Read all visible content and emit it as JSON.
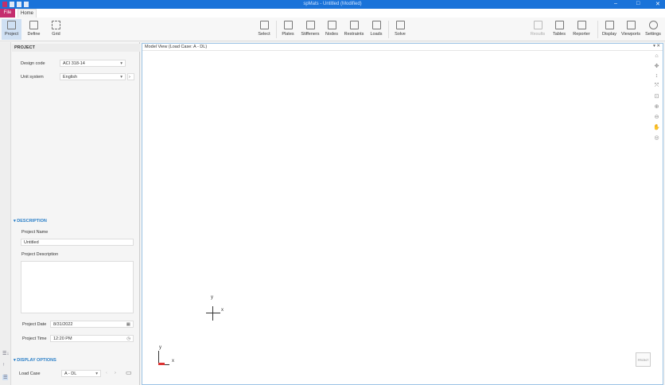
{
  "window": {
    "title": "spMats - Untitled (Modified)",
    "minimize": "–",
    "maximize": "□",
    "close": "✕"
  },
  "tabs": {
    "file": "File",
    "home": "Home"
  },
  "ribbon": {
    "left": [
      {
        "label": "Project",
        "icon": "project-icon"
      },
      {
        "label": "Define",
        "icon": "define-icon"
      },
      {
        "label": "Grid",
        "icon": "grid-icon"
      }
    ],
    "mid": [
      {
        "label": "Select",
        "icon": "cursor-icon"
      },
      {
        "label": "Plates",
        "icon": "plates-icon"
      },
      {
        "label": "Stiffeners",
        "icon": "stiffeners-icon"
      },
      {
        "label": "Nodes",
        "icon": "nodes-icon"
      },
      {
        "label": "Restraints",
        "icon": "restraints-icon"
      },
      {
        "label": "Loads",
        "icon": "loads-icon"
      },
      {
        "label": "Solve",
        "icon": "solve-icon"
      }
    ],
    "right": [
      {
        "label": "Results",
        "icon": "results-icon"
      },
      {
        "label": "Tables",
        "icon": "tables-icon"
      },
      {
        "label": "Reporter",
        "icon": "reporter-icon"
      },
      {
        "label": "Display",
        "icon": "display-icon"
      },
      {
        "label": "Viewports",
        "icon": "viewports-icon"
      },
      {
        "label": "Settings",
        "icon": "gear-icon"
      }
    ]
  },
  "panel": {
    "project_header": "PROJECT",
    "design_code_label": "Design code",
    "design_code": "ACI 318-14",
    "unit_system_label": "Unit system",
    "unit_system": "English",
    "description_header": "DESCRIPTION",
    "project_name_label": "Project Name",
    "project_name": "Untitled",
    "project_description_label": "Project Description",
    "project_description": "",
    "project_date_label": "Project Date",
    "project_date": "8/31/2022",
    "project_time_label": "Project Time",
    "project_time": "12:20 PM",
    "display_header": "DISPLAY OPTIONS",
    "load_case_label": "Load Case",
    "load_case": "A - DL"
  },
  "view": {
    "title": "Model View (Load Case: A - DL)",
    "axis_x": "x",
    "axis_y": "y",
    "cube": "FRONT"
  }
}
